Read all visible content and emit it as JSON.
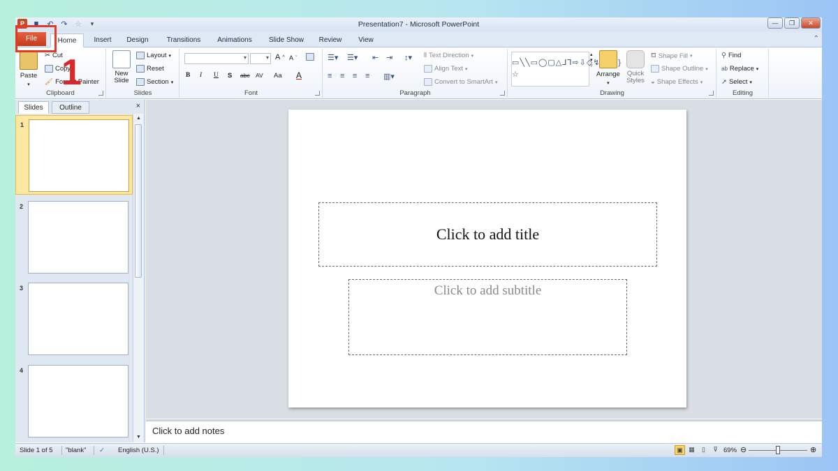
{
  "window": {
    "title": "Presentation7 - Microsoft PowerPoint",
    "qat_icons": [
      "powerpoint-logo-icon",
      "save-icon",
      "undo-icon",
      "redo-icon",
      "customize-qat-icon"
    ]
  },
  "tabs": {
    "file": "File",
    "items": [
      "Home",
      "Insert",
      "Design",
      "Transitions",
      "Animations",
      "Slide Show",
      "Review",
      "View"
    ],
    "active": "Home"
  },
  "ribbon": {
    "clipboard": {
      "label": "Clipboard",
      "paste": "Paste",
      "cut": "Cut",
      "copy": "Copy",
      "format_painter": "Format Painter"
    },
    "slides": {
      "label": "Slides",
      "new_slide": "New Slide",
      "layout": "Layout",
      "reset": "Reset",
      "section": "Section"
    },
    "font": {
      "label": "Font",
      "bold": "B",
      "italic": "I",
      "underline": "U",
      "shadow": "S",
      "strike": "abc",
      "spacing": "AV",
      "case": "Aa",
      "color": "A",
      "grow": "A",
      "shrink": "A"
    },
    "paragraph": {
      "label": "Paragraph",
      "text_direction": "Text Direction",
      "align_text": "Align Text",
      "convert_smartart": "Convert to SmartArt"
    },
    "drawing": {
      "label": "Drawing",
      "arrange": "Arrange",
      "quick_styles": "Quick Styles",
      "shape_fill": "Shape Fill",
      "shape_outline": "Shape Outline",
      "shape_effects": "Shape Effects"
    },
    "editing": {
      "label": "Editing",
      "find": "Find",
      "replace": "Replace",
      "select": "Select"
    }
  },
  "slides_pane": {
    "tab_slides": "Slides",
    "tab_outline": "Outline",
    "close": "×",
    "thumbnails": [
      "1",
      "2",
      "3",
      "4"
    ],
    "selected": 1
  },
  "slide": {
    "title_placeholder": "Click to add title",
    "subtitle_placeholder": "Click to add subtitle"
  },
  "notes": {
    "placeholder": "Click to add notes"
  },
  "status": {
    "slide_info": "Slide 1 of 5",
    "theme": "\"blank\"",
    "language": "English (U.S.)",
    "zoom": "69%",
    "zoom_level": 0.5
  },
  "annotation": {
    "step": "1",
    "color": "#e4382a"
  }
}
